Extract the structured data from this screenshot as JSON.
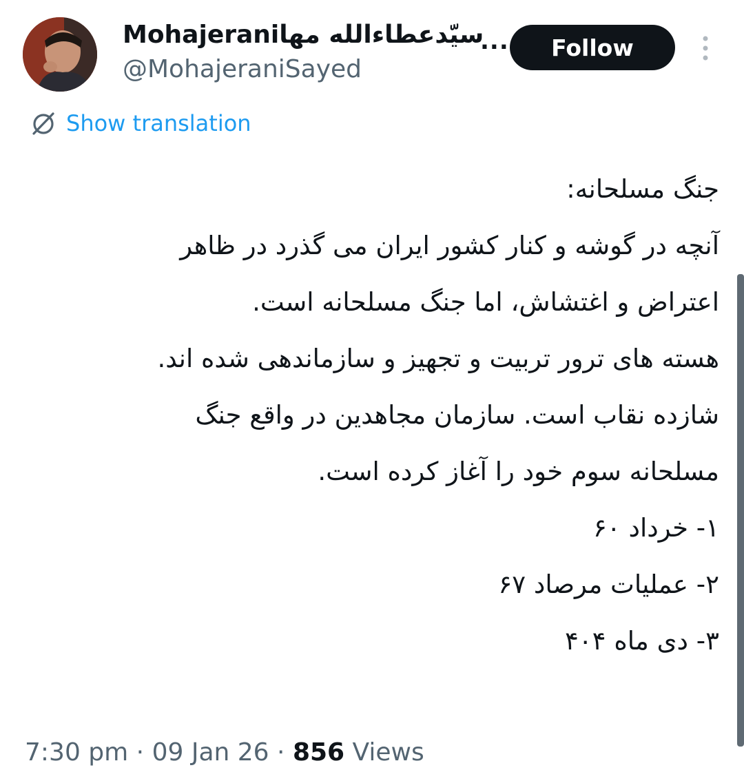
{
  "author": {
    "display_name": "Mohajeraniسیّدعطاءالله مها",
    "handle": "@MohajeraniSayed",
    "avatar_icon": "profile-photo"
  },
  "header": {
    "more_label": "...",
    "follow_label": "Follow",
    "menu_icon": "kebab-menu-icon"
  },
  "translation": {
    "icon": "globe-slash-icon",
    "label": "Show translation"
  },
  "tweet": {
    "lines": [
      "جنگ مسلحانه:",
      "آنچه در  گوشه و کنار کشور ایران می گذرد در ظاهر",
      "اعتراض و اغتشاش،  اما جنگ مسلحانه است.",
      "هسته های ترور تربیت و تجهیز و سازماندهی شده اند.",
      "شازده نقاب است. سازمان مجاهدین در واقع جنگ",
      "مسلحانه سوم خود را آغاز کرده است.",
      "۱- خرداد ۶۰",
      "۲- عملیات مرصاد ۶۷",
      "۳- دی ماه ۴۰۴"
    ]
  },
  "meta": {
    "time": "7:30 pm",
    "separator": "·",
    "date": "09 Jan 26",
    "views_count": "856",
    "views_label": "Views"
  },
  "colors": {
    "accent": "#1d9bf0",
    "text": "#0f1419",
    "secondary": "#536471",
    "button_bg": "#0f1419"
  }
}
